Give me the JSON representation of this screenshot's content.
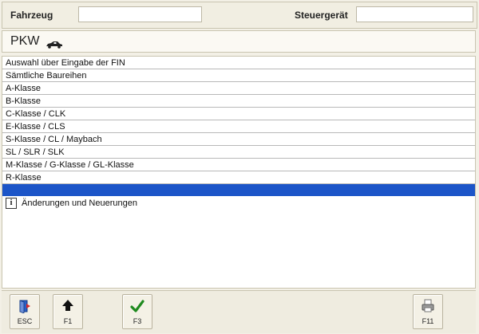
{
  "header": {
    "vehicle_label": "Fahrzeug",
    "vehicle_value": "",
    "ecu_label": "Steuergerät",
    "ecu_value": ""
  },
  "category": {
    "label": "PKW",
    "icon": "car-icon"
  },
  "list": {
    "items": [
      "Auswahl über Eingabe der FIN",
      "Sämtliche Baureihen",
      "A-Klasse",
      "B-Klasse",
      "C-Klasse / CLK",
      "E-Klasse / CLS",
      "S-Klasse / CL / Maybach",
      "SL / SLR / SLK",
      "M-Klasse / G-Klasse / GL-Klasse",
      "R-Klasse"
    ],
    "selected_color": "#1c55c8",
    "info_item": "Änderungen und Neuerungen"
  },
  "toolbar": {
    "esc_label": "ESC",
    "back_label": "F1",
    "confirm_label": "F3",
    "print_label": "F11"
  }
}
